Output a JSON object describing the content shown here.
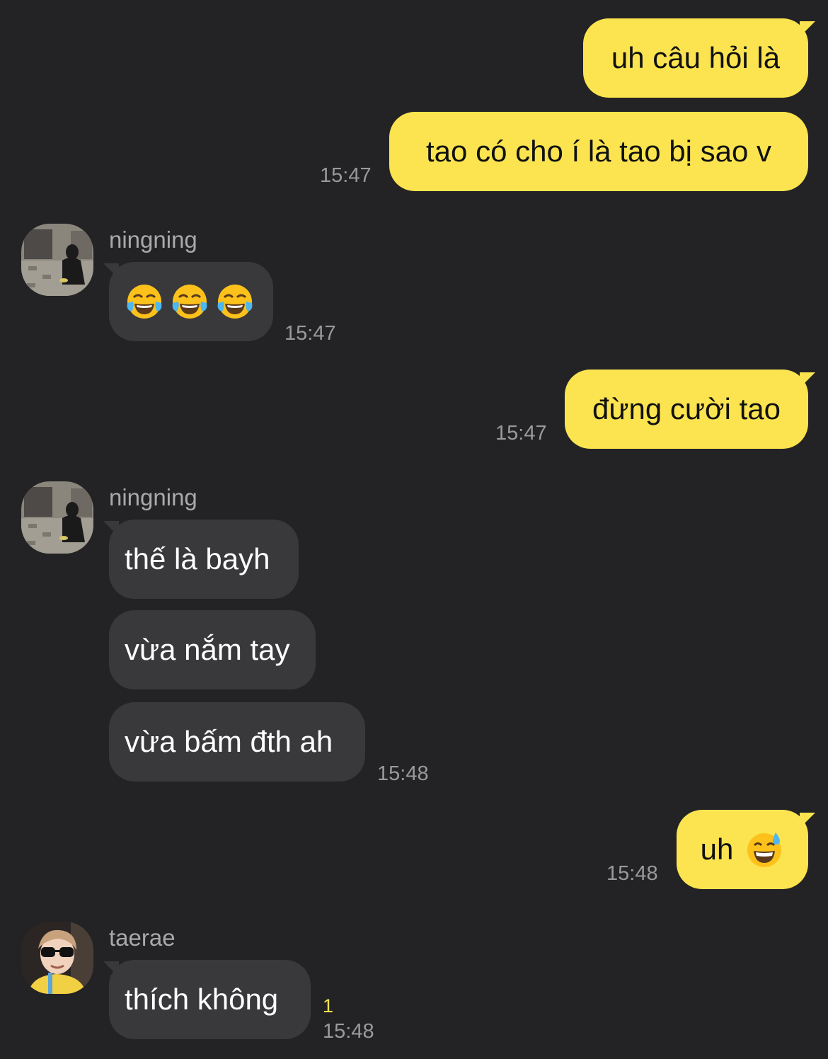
{
  "chat": {
    "messages": [
      {
        "from": "me",
        "text": "uh câu hỏi là"
      },
      {
        "from": "me",
        "text": "tao có cho í là tao bị sao v",
        "time": "15:47"
      },
      {
        "from": "ningning",
        "sender": "ningning",
        "content": [
          "face-with-tears-of-joy-emoji",
          "face-with-tears-of-joy-emoji",
          "face-with-tears-of-joy-emoji"
        ],
        "time": "15:47"
      },
      {
        "from": "me",
        "text": "đừng cười tao",
        "time": "15:47"
      },
      {
        "from": "ningning",
        "sender": "ningning",
        "text": "thế là bayh"
      },
      {
        "from": "ningning",
        "text": "vừa nắm tay"
      },
      {
        "from": "ningning",
        "text": "vừa bấm đth ah",
        "time": "15:48"
      },
      {
        "from": "me",
        "text": "uh",
        "emoji": "grinning-face-with-sweat-emoji",
        "time": "15:48"
      },
      {
        "from": "taerae",
        "sender": "taerae",
        "text": "thích không",
        "unread": "1",
        "time": "15:48"
      }
    ]
  },
  "colors": {
    "background": "#232325",
    "my_bubble": "#fbe44f",
    "their_bubble": "#39393c",
    "timestamp": "#9a9a9e",
    "unread_count": "#fbe44f"
  }
}
